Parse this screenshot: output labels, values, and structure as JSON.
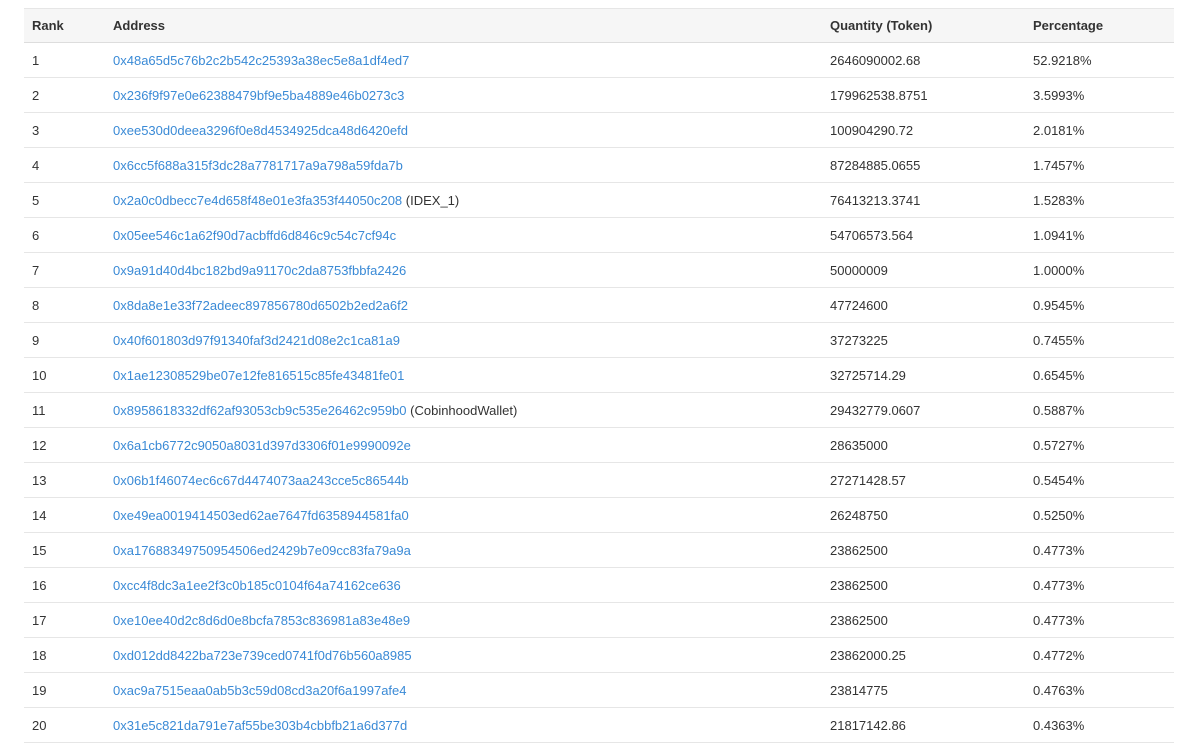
{
  "table": {
    "headers": {
      "rank": "Rank",
      "address": "Address",
      "quantity": "Quantity (Token)",
      "percentage": "Percentage"
    },
    "link_color": "#3a8ad6",
    "rows": [
      {
        "rank": "1",
        "address": "0x48a65d5c76b2c2b542c25393a38ec5e8a1df4ed7",
        "tag": "",
        "quantity": "2646090002.68",
        "percentage": "52.9218%"
      },
      {
        "rank": "2",
        "address": "0x236f9f97e0e62388479bf9e5ba4889e46b0273c3",
        "tag": "",
        "quantity": "179962538.8751",
        "percentage": "3.5993%"
      },
      {
        "rank": "3",
        "address": "0xee530d0deea3296f0e8d4534925dca48d6420efd",
        "tag": "",
        "quantity": "100904290.72",
        "percentage": "2.0181%"
      },
      {
        "rank": "4",
        "address": "0x6cc5f688a315f3dc28a7781717a9a798a59fda7b",
        "tag": "",
        "quantity": "87284885.0655",
        "percentage": "1.7457%"
      },
      {
        "rank": "5",
        "address": "0x2a0c0dbecc7e4d658f48e01e3fa353f44050c208",
        "tag": "(IDEX_1)",
        "quantity": "76413213.3741",
        "percentage": "1.5283%"
      },
      {
        "rank": "6",
        "address": "0x05ee546c1a62f90d7acbffd6d846c9c54c7cf94c",
        "tag": "",
        "quantity": "54706573.564",
        "percentage": "1.0941%"
      },
      {
        "rank": "7",
        "address": "0x9a91d40d4bc182bd9a91170c2da8753fbbfa2426",
        "tag": "",
        "quantity": "50000009",
        "percentage": "1.0000%"
      },
      {
        "rank": "8",
        "address": "0x8da8e1e33f72adeec897856780d6502b2ed2a6f2",
        "tag": "",
        "quantity": "47724600",
        "percentage": "0.9545%"
      },
      {
        "rank": "9",
        "address": "0x40f601803d97f91340faf3d2421d08e2c1ca81a9",
        "tag": "",
        "quantity": "37273225",
        "percentage": "0.7455%"
      },
      {
        "rank": "10",
        "address": "0x1ae12308529be07e12fe816515c85fe43481fe01",
        "tag": "",
        "quantity": "32725714.29",
        "percentage": "0.6545%"
      },
      {
        "rank": "11",
        "address": "0x8958618332df62af93053cb9c535e26462c959b0",
        "tag": "(CobinhoodWallet)",
        "quantity": "29432779.0607",
        "percentage": "0.5887%"
      },
      {
        "rank": "12",
        "address": "0x6a1cb6772c9050a8031d397d3306f01e9990092e",
        "tag": "",
        "quantity": "28635000",
        "percentage": "0.5727%"
      },
      {
        "rank": "13",
        "address": "0x06b1f46074ec6c67d4474073aa243cce5c86544b",
        "tag": "",
        "quantity": "27271428.57",
        "percentage": "0.5454%"
      },
      {
        "rank": "14",
        "address": "0xe49ea0019414503ed62ae7647fd6358944581fa0",
        "tag": "",
        "quantity": "26248750",
        "percentage": "0.5250%"
      },
      {
        "rank": "15",
        "address": "0xa17688349750954506ed2429b7e09cc83fa79a9a",
        "tag": "",
        "quantity": "23862500",
        "percentage": "0.4773%"
      },
      {
        "rank": "16",
        "address": "0xcc4f8dc3a1ee2f3c0b185c0104f64a74162ce636",
        "tag": "",
        "quantity": "23862500",
        "percentage": "0.4773%"
      },
      {
        "rank": "17",
        "address": "0xe10ee40d2c8d6d0e8bcfa7853c836981a83e48e9",
        "tag": "",
        "quantity": "23862500",
        "percentage": "0.4773%"
      },
      {
        "rank": "18",
        "address": "0xd012dd8422ba723e739ced0741f0d76b560a8985",
        "tag": "",
        "quantity": "23862000.25",
        "percentage": "0.4772%"
      },
      {
        "rank": "19",
        "address": "0xac9a7515eaa0ab5b3c59d08cd3a20f6a1997afe4",
        "tag": "",
        "quantity": "23814775",
        "percentage": "0.4763%"
      },
      {
        "rank": "20",
        "address": "0x31e5c821da791e7af55be303b4cbbfb21a6d377d",
        "tag": "",
        "quantity": "21817142.86",
        "percentage": "0.4363%"
      }
    ]
  }
}
